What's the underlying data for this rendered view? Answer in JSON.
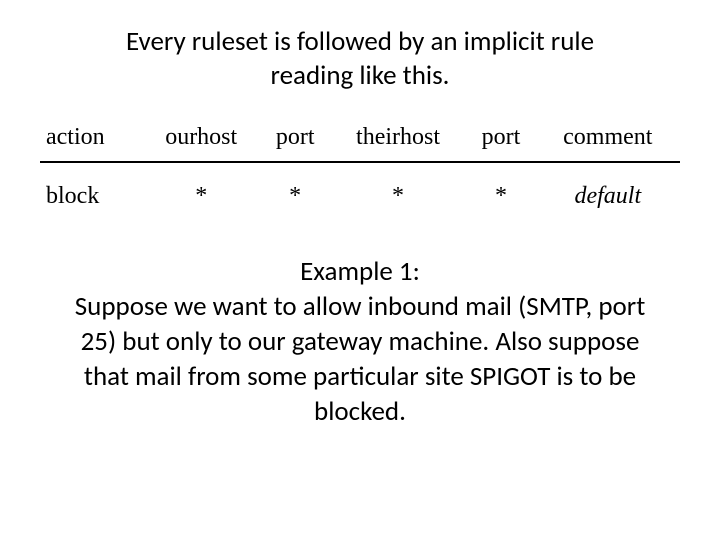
{
  "intro_line1": "Every ruleset is followed by an implicit rule",
  "intro_line2": "reading like this.",
  "table": {
    "headers": [
      "action",
      "ourhost",
      "port",
      "theirhost",
      "port",
      "comment"
    ],
    "row": [
      "block",
      "*",
      "*",
      "*",
      "*",
      "default"
    ]
  },
  "example": {
    "title": "Example 1:",
    "body": "Suppose we want to allow inbound mail (SMTP, port 25) but only to our gateway machine.  Also suppose that mail from some particular site SPIGOT is to be blocked."
  }
}
